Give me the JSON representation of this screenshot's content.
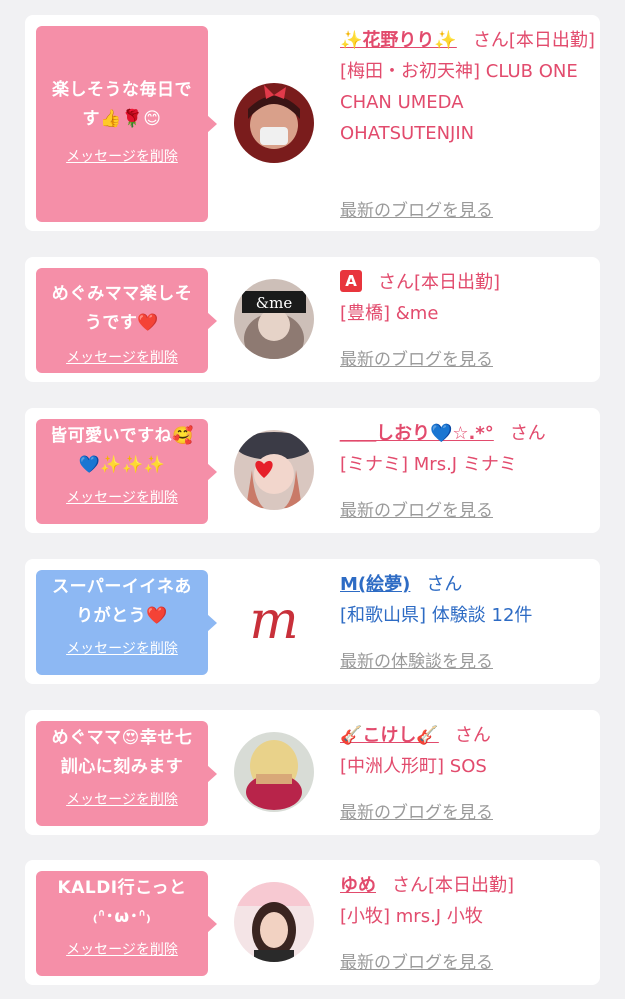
{
  "cards": [
    {
      "message": "楽しそうな毎日です👍🌹😊",
      "delete_label": "メッセージを削除",
      "name": "✨花野りり✨",
      "honorific": "さん",
      "status": "[本日出勤]",
      "shop": "[梅田・お初天神] CLUB ONE CHAN UMEDA OHATSUTENJIN",
      "more_label": "最新のブログを見る"
    },
    {
      "message": "めぐみママ楽しそうです❤️",
      "delete_label": "メッセージを削除",
      "name": "🅰️",
      "honorific": "さん",
      "status": "[本日出勤]",
      "shop": "[豊橋] &me",
      "more_label": "最新のブログを見る",
      "avatar_text": "&me"
    },
    {
      "message": "皆可愛いですね🥰💙✨✨✨",
      "delete_label": "メッセージを削除",
      "name": "＿＿しおり💙☆.*°",
      "honorific": "さん",
      "status": "",
      "shop": "[ミナミ] Mrs.J ミナミ",
      "more_label": "最新のブログを見る"
    },
    {
      "message": "スーパーイイネありがとう❤️",
      "delete_label": "メッセージを削除",
      "name": "M(絵夢)",
      "honorific": "さん",
      "status": "",
      "shop": "[和歌山県] 体験談 12件",
      "more_label": "最新の体験談を見る",
      "avatar_text": "m"
    },
    {
      "message": "めぐママ😍幸せ七訓心に刻みます",
      "delete_label": "メッセージを削除",
      "name": "🎸こけし🎸",
      "honorific": "さん",
      "status": "",
      "shop": "[中洲人形町] SOS",
      "more_label": "最新のブログを見る"
    },
    {
      "message": "KALDI行こっと ₍ᐢ･ω･ᐢ₎",
      "delete_label": "メッセージを削除",
      "name": "ゆめ",
      "honorific": "さん",
      "status": "[本日出勤]",
      "shop": "[小牧] mrs.J 小牧",
      "more_label": "最新のブログを見る"
    }
  ],
  "colors": {
    "pink_bubble": "#f58fa8",
    "blue_bubble": "#8db8f3",
    "pink_text": "#e24b6d",
    "blue_text": "#2d6bc4",
    "muted_link": "#9a9a9a",
    "background": "#f1f1f3"
  }
}
